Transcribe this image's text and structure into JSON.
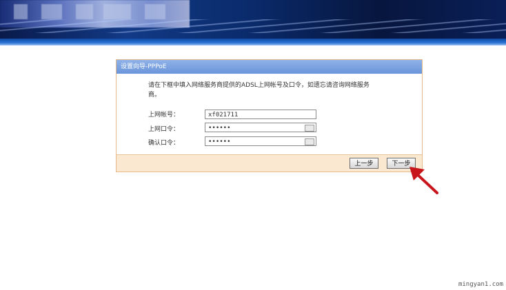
{
  "dialog": {
    "title": "设置向导-PPPoE",
    "instruction": "请在下框中填入网络服务商提供的ADSL上网帐号及口令，如遗忘请咨询网络服务商。",
    "fields": [
      {
        "label": "上网帐号：",
        "value": "xf021711"
      },
      {
        "label": "上网口令：",
        "value": "••••••"
      },
      {
        "label": "确认口令：",
        "value": "••••••"
      }
    ],
    "buttons": {
      "prev": "上一步",
      "next": "下一步"
    }
  },
  "watermark": "mingyan1.com",
  "colors": {
    "banner": "#0a1f57",
    "panel_title": "#7aa0e0",
    "footer": "#fbe8d0",
    "arrow": "#c8151c"
  }
}
